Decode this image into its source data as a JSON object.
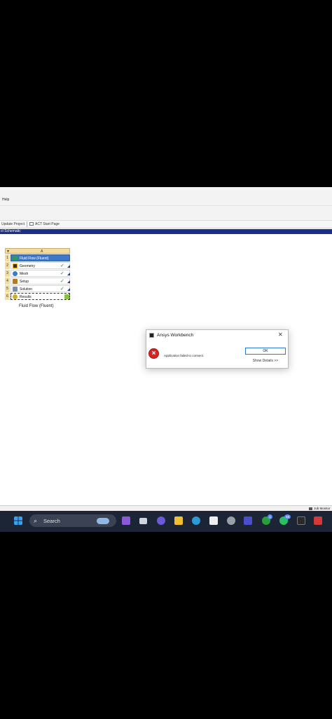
{
  "menubar": {
    "help_label": "Help"
  },
  "toolbar": {
    "update_project": "Update Project",
    "act_start_page": "ACT Start Page"
  },
  "schematic": {
    "header": "ct Schematic"
  },
  "system": {
    "column_letter": "A",
    "rows": [
      {
        "num": "1",
        "label": "Fluid Flow (Fluent)",
        "icon": "fluid-flow-icon"
      },
      {
        "num": "2",
        "label": "Geometry",
        "icon": "geometry-icon",
        "status": "✓"
      },
      {
        "num": "3",
        "label": "Mesh",
        "icon": "mesh-icon",
        "status": "✓"
      },
      {
        "num": "4",
        "label": "Setup",
        "icon": "setup-icon",
        "status": "✓"
      },
      {
        "num": "5",
        "label": "Solution",
        "icon": "solution-icon",
        "status": "✓"
      },
      {
        "num": "6",
        "label": "Results",
        "icon": "results-icon"
      }
    ],
    "name": "Fluid Flow (Fluent)"
  },
  "dialog": {
    "title": "Ansys Workbench",
    "message": "Application failed to connect.",
    "ok_label": "OK",
    "details_label": "Show Details >>",
    "close_glyph": "✕"
  },
  "statusbar": {
    "job_monitor": "Job Monitor"
  },
  "taskbar": {
    "search_label": "Search",
    "badges": {
      "xbox": "1",
      "whatsapp": "48"
    }
  },
  "colors": {
    "schematic_header": "#1a2e8c",
    "system_header": "#f4dc9e",
    "selected_row": "#3d78c8",
    "error_icon": "#d42424",
    "taskbar": "#1c2536"
  }
}
